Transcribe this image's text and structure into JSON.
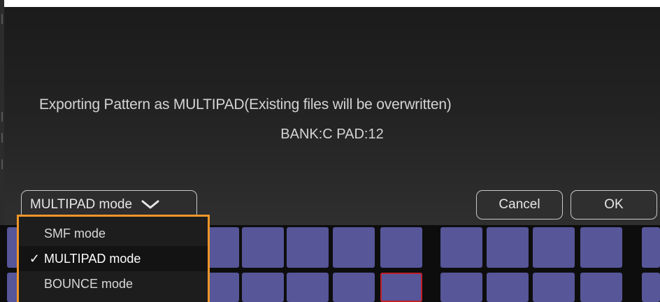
{
  "dialog": {
    "message": "Exporting Pattern as MULTIPAD(Existing files will be overwritten)",
    "target": "BANK:C PAD:12"
  },
  "mode_select": {
    "selected_label": "MULTIPAD mode",
    "icon": "chevron-down-icon",
    "options": [
      {
        "label": "SMF mode",
        "checked": false
      },
      {
        "label": "MULTIPAD mode",
        "checked": true
      },
      {
        "label": "BOUNCE mode",
        "checked": false
      }
    ],
    "check_mark": "✓"
  },
  "buttons": {
    "cancel_label": "Cancel",
    "ok_label": "OK"
  },
  "colors": {
    "pad": "#565699",
    "pad_selected_border": "#c0202a",
    "dropdown_border": "#f0962a",
    "dialog_bg": "#222222"
  }
}
